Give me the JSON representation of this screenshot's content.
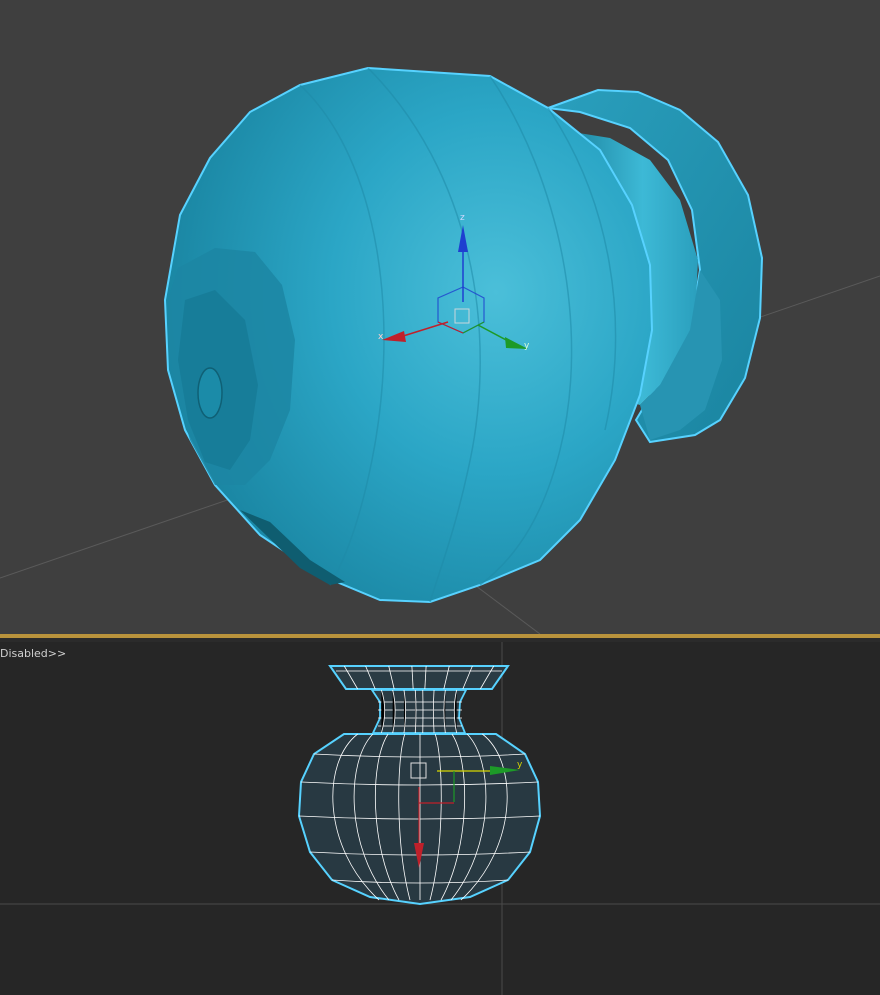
{
  "viewports": {
    "perspective": {
      "object_color": "#29a8c8",
      "selection_color": "#57d2ff",
      "gizmo": {
        "x_label": "x",
        "y_label": "y",
        "z_label": "z",
        "x_color": "#c0202a",
        "y_color": "#1d9a28",
        "z_color": "#1e3fd0"
      }
    },
    "bottom": {
      "label": "Disabled>>",
      "gizmo": {
        "y_label": "y"
      }
    },
    "active_border_color": "#b9933c"
  }
}
